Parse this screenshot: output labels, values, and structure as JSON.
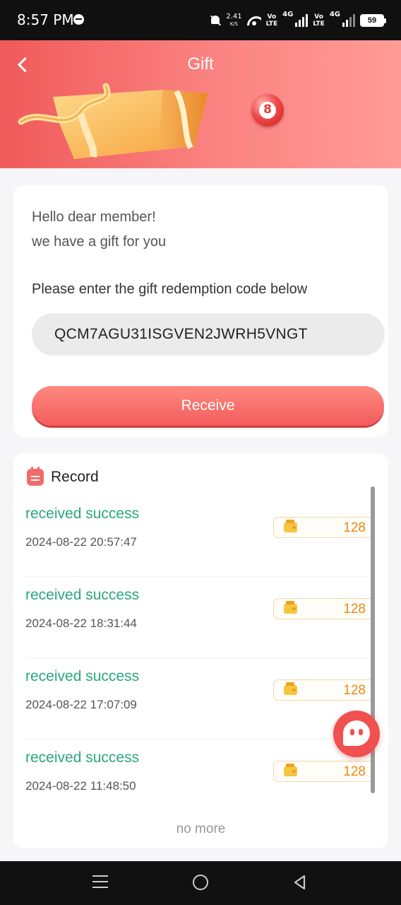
{
  "status_bar": {
    "time": "8:57 PM",
    "net_speed_value": "2.41",
    "net_speed_unit": "K/S",
    "volte_1": "Vo\nLTE",
    "sig1_label": "4G",
    "sig2_label": "4G",
    "battery": "59"
  },
  "header": {
    "title": "Gift",
    "ball_number": "8"
  },
  "redeem": {
    "greeting_line1": "Hello dear member!",
    "greeting_line2": "we have a gift for you",
    "instruction": "Please enter the gift redemption code below",
    "code_value": "QCM7AGU31ISGVEN2JWRH5VNGT",
    "receive_label": "Receive"
  },
  "record": {
    "title": "Record",
    "items": [
      {
        "status": "received success",
        "time": "2024-08-22 20:57:47",
        "amount": "128"
      },
      {
        "status": "received success",
        "time": "2024-08-22 18:31:44",
        "amount": "128"
      },
      {
        "status": "received success",
        "time": "2024-08-22 17:07:09",
        "amount": "128"
      },
      {
        "status": "received success",
        "time": "2024-08-22 11:48:50",
        "amount": "128"
      }
    ],
    "no_more": "no more"
  },
  "colors": {
    "accent": "#f25c5c",
    "success_text": "#2aa77b",
    "amount_text": "#e98a17"
  },
  "icons": {
    "back": "chevron-left-icon",
    "record": "calendar-icon",
    "wallet": "wallet-icon",
    "chat": "chat-icon"
  }
}
